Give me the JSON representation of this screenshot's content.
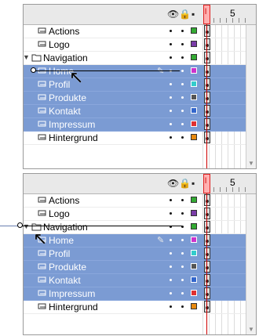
{
  "panels": [
    {
      "header": {
        "frame_number": "5",
        "playhead_label": "l"
      },
      "rows": [
        {
          "name": "Actions",
          "type": "layer",
          "selected": false,
          "color": "#33aa33"
        },
        {
          "name": "Logo",
          "type": "layer",
          "selected": false,
          "color": "#7a3ca8"
        },
        {
          "name": "Navigation",
          "type": "folder",
          "selected": false,
          "color": "#33aa33"
        },
        {
          "name": "Home",
          "type": "layer",
          "selected": true,
          "color": "#cc33cc",
          "editing": true
        },
        {
          "name": "Profil",
          "type": "layer",
          "selected": true,
          "color": "#33cccc"
        },
        {
          "name": "Produkte",
          "type": "layer",
          "selected": true,
          "color": "#555555"
        },
        {
          "name": "Kontakt",
          "type": "layer",
          "selected": true,
          "color": "#3366cc"
        },
        {
          "name": "Impressum",
          "type": "layer",
          "selected": true,
          "color": "#e03030"
        },
        {
          "name": "Hintergrund",
          "type": "layer",
          "selected": false,
          "color": "#e88a10"
        }
      ]
    },
    {
      "header": {
        "frame_number": "5",
        "playhead_label": "l"
      },
      "rows": [
        {
          "name": "Actions",
          "type": "layer",
          "selected": false,
          "color": "#33aa33"
        },
        {
          "name": "Logo",
          "type": "layer",
          "selected": false,
          "color": "#7a3ca8"
        },
        {
          "name": "Navigation",
          "type": "folder",
          "selected": false,
          "color": "#33aa33"
        },
        {
          "name": "Home",
          "type": "layer",
          "selected": true,
          "color": "#cc33cc",
          "editing": true
        },
        {
          "name": "Profil",
          "type": "layer",
          "selected": true,
          "color": "#33cccc"
        },
        {
          "name": "Produkte",
          "type": "layer",
          "selected": true,
          "color": "#555555"
        },
        {
          "name": "Kontakt",
          "type": "layer",
          "selected": true,
          "color": "#3366cc"
        },
        {
          "name": "Impressum",
          "type": "layer",
          "selected": true,
          "color": "#e03030"
        },
        {
          "name": "Hintergrund",
          "type": "layer",
          "selected": false,
          "color": "#e88a10"
        }
      ]
    }
  ],
  "icons": {
    "visibility": "eye-icon",
    "lock": "lock-icon",
    "outline": "outline-icon"
  }
}
